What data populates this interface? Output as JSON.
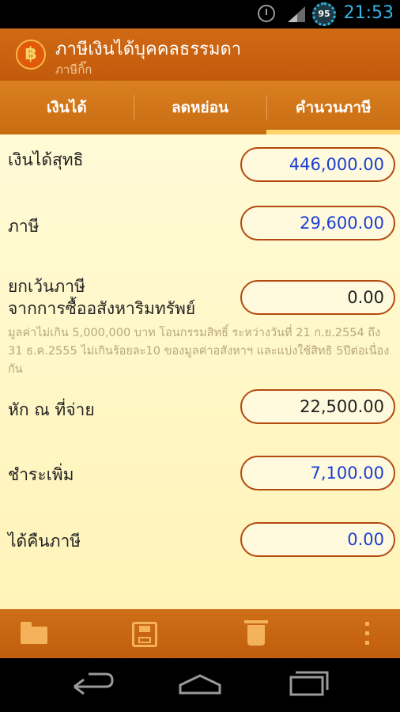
{
  "status_bar": {
    "time": "21:53",
    "battery": "95",
    "icons": [
      "alarm-icon",
      "signal-icon",
      "battery-icon"
    ]
  },
  "app_bar": {
    "logo": "฿",
    "title": "ภาษีเงินได้บุคคลธรรมดา",
    "subtitle": "ภาษีกิ๊ก"
  },
  "tabs": [
    {
      "label": "เงินได้",
      "active": false
    },
    {
      "label": "ลดหย่อน",
      "active": false
    },
    {
      "label": "คำนวนภาษี",
      "active": true
    }
  ],
  "fields": {
    "net_income": {
      "label": "เงินได้สุทธิ",
      "value": "446,000.00"
    },
    "tax": {
      "label": "ภาษี",
      "value": "29,600.00"
    },
    "exemption": {
      "label_line1": "ยกเว้นภาษี",
      "label_line2": "จากการซื้ออสังหาริมทรัพย์",
      "value": "0.00"
    },
    "withheld": {
      "label": "หัก ณ ที่จ่าย",
      "value": "22,500.00"
    },
    "additional_payment": {
      "label": "ชำระเพิ่ม",
      "value": "7,100.00"
    },
    "refund": {
      "label": "ได้คืนภาษี",
      "value": "0.00"
    }
  },
  "exemption_note": "มูลค่าไม่เกิน 5,000,000 บาท โอนกรรมสิทธิ์ ระหว่างวันที่ 21 ก.ย.2554 ถึง 31 ธ.ค.2555 ไม่เกินร้อยละ10 ของมูลค่าอสังหาฯ และแบ่งใช้สิทธิ 5ปีต่อเนื่องกัน",
  "toolbar": [
    "folder-icon",
    "save-icon",
    "trash-icon",
    "overflow-menu-icon"
  ],
  "nav_bar": [
    "back-icon",
    "home-icon",
    "recent-apps-icon"
  ],
  "colors": {
    "app_bar": "#c85f10",
    "tab_indicator": "#ffd46b",
    "field_border": "#b34a10",
    "blue_value": "#1a3fd4",
    "status_clock": "#33b5e5"
  }
}
